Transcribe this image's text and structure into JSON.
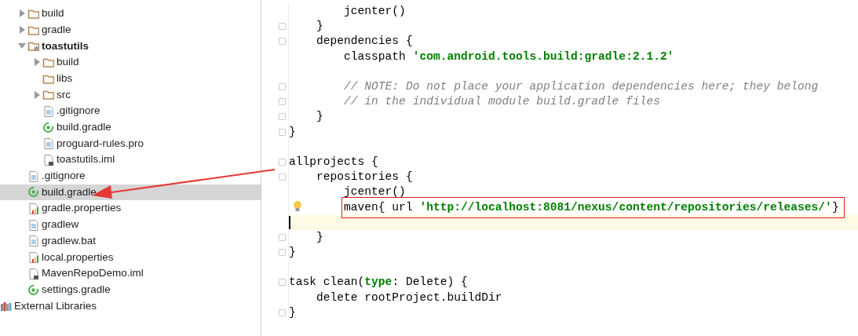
{
  "project_tree": {
    "items": [
      {
        "name": "build",
        "kind": "folder",
        "expanded": false,
        "selected": false
      },
      {
        "name": "gradle",
        "kind": "folder",
        "expanded": false,
        "selected": false
      },
      {
        "name": "toastutils",
        "kind": "module",
        "expanded": true,
        "selected": false,
        "children": [
          {
            "name": "build",
            "kind": "folder",
            "expanded": false,
            "selected": false
          },
          {
            "name": "libs",
            "kind": "folder",
            "selected": false
          },
          {
            "name": "src",
            "kind": "folder",
            "expanded": false,
            "selected": false
          },
          {
            "name": ".gitignore",
            "kind": "text",
            "selected": false
          },
          {
            "name": "build.gradle",
            "kind": "gradle",
            "selected": false
          },
          {
            "name": "proguard-rules.pro",
            "kind": "text",
            "selected": false
          },
          {
            "name": "toastutils.iml",
            "kind": "iml",
            "selected": false
          }
        ]
      },
      {
        "name": ".gitignore",
        "kind": "text",
        "selected": false
      },
      {
        "name": "build.gradle",
        "kind": "gradle",
        "selected": true
      },
      {
        "name": "gradle.properties",
        "kind": "properties",
        "selected": false
      },
      {
        "name": "gradlew",
        "kind": "text",
        "selected": false
      },
      {
        "name": "gradlew.bat",
        "kind": "text",
        "selected": false
      },
      {
        "name": "local.properties",
        "kind": "properties",
        "selected": false
      },
      {
        "name": "MavenRepoDemo.iml",
        "kind": "iml",
        "selected": false
      },
      {
        "name": "settings.gradle",
        "kind": "gradle",
        "selected": false
      }
    ],
    "external": {
      "name": "External Libraries",
      "kind": "library"
    }
  },
  "editor": {
    "lines": [
      {
        "tokens": [
          {
            "text": "        jcenter()",
            "kind": "plain"
          }
        ]
      },
      {
        "fold": true,
        "tokens": [
          {
            "text": "    }",
            "kind": "plain"
          }
        ]
      },
      {
        "fold": true,
        "tokens": [
          {
            "text": "    dependencies {",
            "kind": "plain"
          }
        ]
      },
      {
        "tokens": [
          {
            "text": "        classpath ",
            "kind": "plain"
          },
          {
            "text": "'com.android.tools.build:gradle:2.1.2'",
            "kind": "string"
          }
        ]
      },
      {
        "space_before": true,
        "fold": true,
        "tokens": [
          {
            "text": "        // NOTE: Do not place your application dependencies here; they belong",
            "kind": "comment"
          }
        ]
      },
      {
        "fold": true,
        "tokens": [
          {
            "text": "        // in the individual module build.gradle files",
            "kind": "comment"
          }
        ]
      },
      {
        "fold": true,
        "tokens": [
          {
            "text": "    }",
            "kind": "plain"
          }
        ]
      },
      {
        "fold": true,
        "tokens": [
          {
            "text": "}",
            "kind": "plain"
          }
        ]
      },
      {
        "space_before": true,
        "fold": true,
        "tokens": [
          {
            "text": "allprojects {",
            "kind": "plain"
          }
        ]
      },
      {
        "fold": true,
        "tokens": [
          {
            "text": "    repositories {",
            "kind": "plain"
          }
        ]
      },
      {
        "tokens": [
          {
            "text": "        jcenter()",
            "kind": "plain"
          }
        ]
      },
      {
        "bulb": true,
        "boxed": true,
        "tokens": [
          {
            "text": "        maven{ url ",
            "kind": "plain"
          },
          {
            "text": "'http://localhost:8081/nexus/content/repositories/releases/'",
            "kind": "string"
          },
          {
            "text": "}",
            "kind": "plain"
          }
        ]
      },
      {
        "current": true
      },
      {
        "fold": true,
        "tokens": [
          {
            "text": "    }",
            "kind": "plain"
          }
        ]
      },
      {
        "fold": true,
        "tokens": [
          {
            "text": "}",
            "kind": "plain"
          }
        ]
      },
      {
        "space_before": true,
        "fold": true,
        "tokens": [
          {
            "text": "task clean(",
            "kind": "plain"
          },
          {
            "text": "type",
            "kind": "keyword"
          },
          {
            "text": ": Delete) {",
            "kind": "plain"
          }
        ]
      },
      {
        "tokens": [
          {
            "text": "    delete rootProject.buildDir",
            "kind": "plain"
          }
        ]
      },
      {
        "fold": true,
        "tokens": [
          {
            "text": "}",
            "kind": "plain"
          }
        ]
      }
    ]
  }
}
